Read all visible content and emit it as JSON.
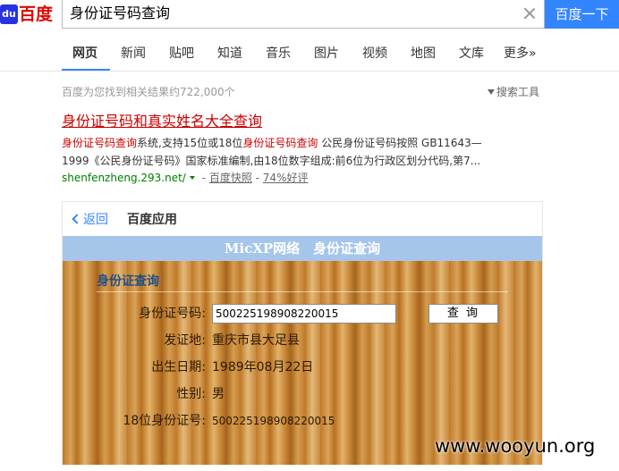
{
  "header": {
    "logo_text": "百度",
    "logo_badge": "du",
    "query": "身份证号码查询",
    "search_button": "百度一下"
  },
  "tabs": [
    {
      "label": "网页",
      "active": true
    },
    {
      "label": "新闻"
    },
    {
      "label": "贴吧"
    },
    {
      "label": "知道"
    },
    {
      "label": "音乐"
    },
    {
      "label": "图片"
    },
    {
      "label": "视频"
    },
    {
      "label": "地图"
    },
    {
      "label": "文库"
    },
    {
      "label": "更多»"
    }
  ],
  "results_meta": {
    "count_text": "百度为您找到相关结果约722,000个",
    "tools_label": "搜索工具"
  },
  "result": {
    "title": "身份证号码和真实姓名大全查询",
    "desc_line1": {
      "hl1": "身份证号码查询",
      "t1": "系统,支持15位或18位",
      "hl2": "身份证号码查询",
      "t2": " 公民身份证号码按照 GB11643—"
    },
    "desc_line2": "1999《公民身份证号码》国家标准编制,由18位数字组成:前6位为行政区划分代码,第7...",
    "url": "shenfenzheng.293.net/",
    "sep1": " - ",
    "snapshot": "百度快照",
    "sep2": " - ",
    "rating": "74%好评"
  },
  "app_card": {
    "back_label": "返回",
    "title": "百度应用",
    "banner": "MicXP网络　身份证查询",
    "section_title": "身份证查询",
    "id_label": "身份证号码:",
    "id_value": "500225198908220015",
    "query_button": "查 询",
    "rows": [
      {
        "label": "发证地:",
        "value": "重庆市县大足县"
      },
      {
        "label": "出生日期:",
        "value": "1989年08月22日"
      },
      {
        "label": "性别:",
        "value": "男"
      },
      {
        "label": "18位身份证号:",
        "value": "500225198908220015"
      }
    ]
  },
  "watermark": "www.wooyun.org",
  "colors": {
    "accent": "#3385ff",
    "title_red": "#cc0000",
    "url_green": "#008000",
    "banner": "#a5c6ea"
  }
}
